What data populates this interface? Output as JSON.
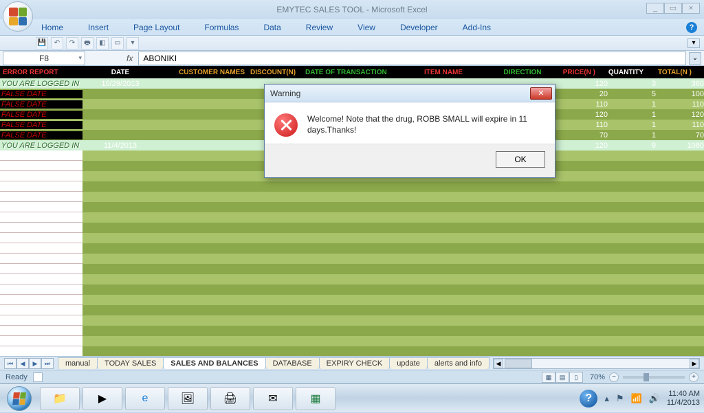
{
  "window": {
    "title": "EMYTEC SALES TOOL  -  Microsoft Excel",
    "min": "_",
    "max": "▭",
    "close": "×"
  },
  "ribbon": {
    "tabs": [
      "Home",
      "Insert",
      "Page Layout",
      "Formulas",
      "Data",
      "Review",
      "View",
      "Developer",
      "Add-Ins"
    ]
  },
  "namebox": "F8",
  "fx_label": "fx",
  "formula": "ABONIKI",
  "headers": {
    "err": "ERROR REPORT",
    "date": "DATE",
    "cust": "CUSTOMER NAMES",
    "disc": "DISCOUNT(N)",
    "dot": "DATE OF TRANSACTION",
    "item": "ITEM NAME",
    "dir": "DIRECTION",
    "price": "PRICE(N )",
    "qty": "QUANTITY",
    "tot": "TOTAL(N )"
  },
  "rows": [
    {
      "kind": "logged",
      "err": "YOU ARE LOGGED IN",
      "date": "10/29/2013",
      "price": "120",
      "qty": "3",
      "tot": "360"
    },
    {
      "kind": "false",
      "err": "FALSE DATE",
      "date": "",
      "price": "20",
      "qty": "5",
      "tot": "100"
    },
    {
      "kind": "false",
      "err": "FALSE DATE",
      "date": "",
      "price": "110",
      "qty": "1",
      "tot": "110"
    },
    {
      "kind": "false",
      "err": "FALSE DATE",
      "date": "",
      "price": "120",
      "qty": "1",
      "tot": "120"
    },
    {
      "kind": "false",
      "err": "FALSE DATE",
      "date": "",
      "price": "110",
      "qty": "1",
      "tot": "110"
    },
    {
      "kind": "false",
      "err": "FALSE DATE",
      "date": "",
      "price": "70",
      "qty": "1",
      "tot": "70"
    },
    {
      "kind": "logged",
      "err": "YOU ARE LOGGED IN",
      "date": "11/4/2013",
      "price": "120",
      "qty": "9",
      "tot": "1080"
    }
  ],
  "sheet_tabs": [
    "manual",
    "TODAY SALES",
    "SALES AND BALANCES",
    "DATABASE",
    "EXPIRY CHECK",
    "update",
    "alerts and info"
  ],
  "active_tab_index": 2,
  "status": {
    "ready": "Ready",
    "zoom": "70%"
  },
  "dialog": {
    "title": "Warning",
    "message": "Welcome! Note that the drug, ROBB SMALL will expire in 11 days.Thanks!",
    "ok": "OK"
  },
  "tray": {
    "time": "11:40 AM",
    "date": "11/4/2013"
  }
}
